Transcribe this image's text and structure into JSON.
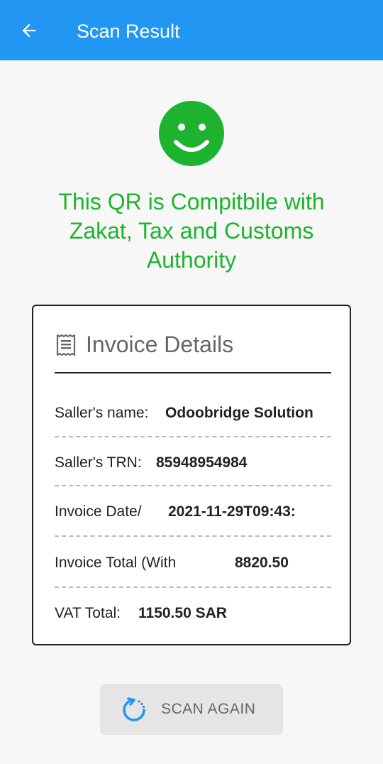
{
  "app_bar": {
    "title": "Scan Result",
    "back_icon": "arrow-left-icon",
    "color": "#2196f3"
  },
  "status": {
    "icon": "smiley-icon",
    "message": "This QR is Compitbile with Zakat, Tax and Customs Authority",
    "color": "#1db32f"
  },
  "invoice": {
    "title": "Invoice Details",
    "icon": "receipt-icon",
    "rows": [
      {
        "label": "Saller's name:",
        "value": "Odoobridge Solution"
      },
      {
        "label": "Saller's TRN:",
        "value": "85948954984"
      },
      {
        "label": "Invoice Date/",
        "value": "2021-11-29T09:43:"
      },
      {
        "label": "Invoice Total (With",
        "value": "8820.50"
      },
      {
        "label": "VAT Total:",
        "value": "1150.50 SAR"
      }
    ]
  },
  "actions": {
    "scan_again_label": "SCAN AGAIN",
    "scan_again_icon": "refresh-icon"
  }
}
